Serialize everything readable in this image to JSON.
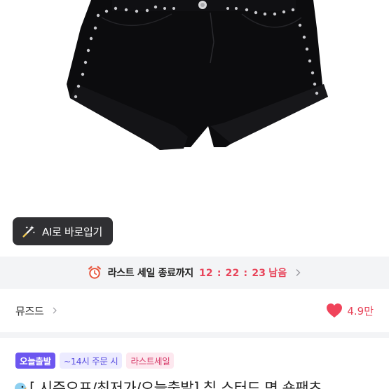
{
  "product": {
    "image_icon": "black-studded-shorts-image"
  },
  "ai_button": {
    "label": "AI로 바로입기",
    "icon": "magic-wand-icon"
  },
  "sale_banner": {
    "label": "라스트 세일 종료까지",
    "hours": "12",
    "minutes": "22",
    "seconds": "23",
    "separator": ":",
    "remain_label": "남음",
    "icon": "alarm-clock-icon",
    "accent_color": "#e8445a"
  },
  "store": {
    "name": "뮤즈드",
    "likes": "4.9만",
    "heart_color": "#f0435a"
  },
  "badges": [
    {
      "label": "오늘출발"
    },
    {
      "label": "~14시 주문 시"
    },
    {
      "label": "라스트세일"
    }
  ],
  "title": {
    "text": "[ 시즌오프/최저가/오늘출발] 칩 스터드 면 숏팬츠"
  }
}
